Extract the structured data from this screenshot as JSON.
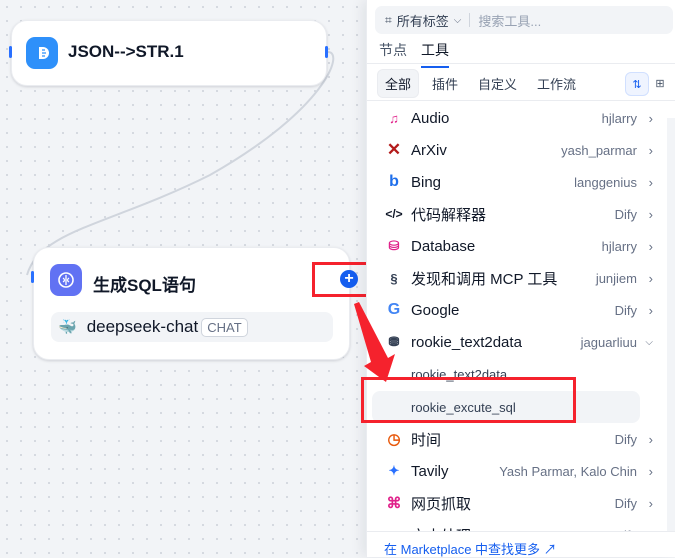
{
  "canvas": {
    "node1": {
      "title": "JSON-->STR.1"
    },
    "node2": {
      "title": "生成SQL语句",
      "model": "deepseek-chat",
      "model_badge": "CHAT",
      "add_symbol": "+"
    }
  },
  "panel": {
    "tag_filter": "所有标签",
    "search_placeholder": "搜索工具...",
    "tabs": [
      "节点",
      "工具"
    ],
    "active_tab": "工具",
    "filters": [
      "全部",
      "插件",
      "自定义",
      "工作流"
    ],
    "active_filter": "全部",
    "tools": [
      {
        "name": "Audio",
        "author": "hjlarry",
        "icon": "audio-icon",
        "color": "#e0218a"
      },
      {
        "name": "ArXiv",
        "author": "yash_parmar",
        "icon": "arxiv-icon",
        "color": "#b31b1b"
      },
      {
        "name": "Bing",
        "author": "langgenius",
        "icon": "bing-icon",
        "color": "#1f6feb"
      },
      {
        "name": "代码解释器",
        "author": "Dify",
        "icon": "code-icon",
        "color": "#101828"
      },
      {
        "name": "Database",
        "author": "hjlarry",
        "icon": "database-icon",
        "color": "#e0218a"
      },
      {
        "name": "发现和调用 MCP 工具",
        "author": "junjiem",
        "icon": "mcp-icon",
        "color": "#344054"
      },
      {
        "name": "Google",
        "author": "Dify",
        "icon": "google-icon",
        "color": "#4285f4"
      },
      {
        "name": "rookie_text2data",
        "author": "jaguarliuu",
        "icon": "database-stack-icon",
        "color": "#344054"
      },
      {
        "name": "时间",
        "author": "Dify",
        "icon": "clock-icon",
        "color": "#e8590c"
      },
      {
        "name": "Tavily",
        "author": "Yash Parmar, Kalo Chin",
        "icon": "tavily-icon",
        "color": "#2970ff"
      },
      {
        "name": "网页抓取",
        "author": "Dify",
        "icon": "webscraper-icon",
        "color": "#e0218a"
      },
      {
        "name": "文本处理",
        "author": "Dify",
        "icon": "text-icon",
        "color": "#f04438"
      }
    ],
    "subtools": [
      "rookie_text2data",
      "rookie_excute_sql"
    ],
    "marketplace_link": "在 Marketplace 中查找更多 ↗"
  }
}
